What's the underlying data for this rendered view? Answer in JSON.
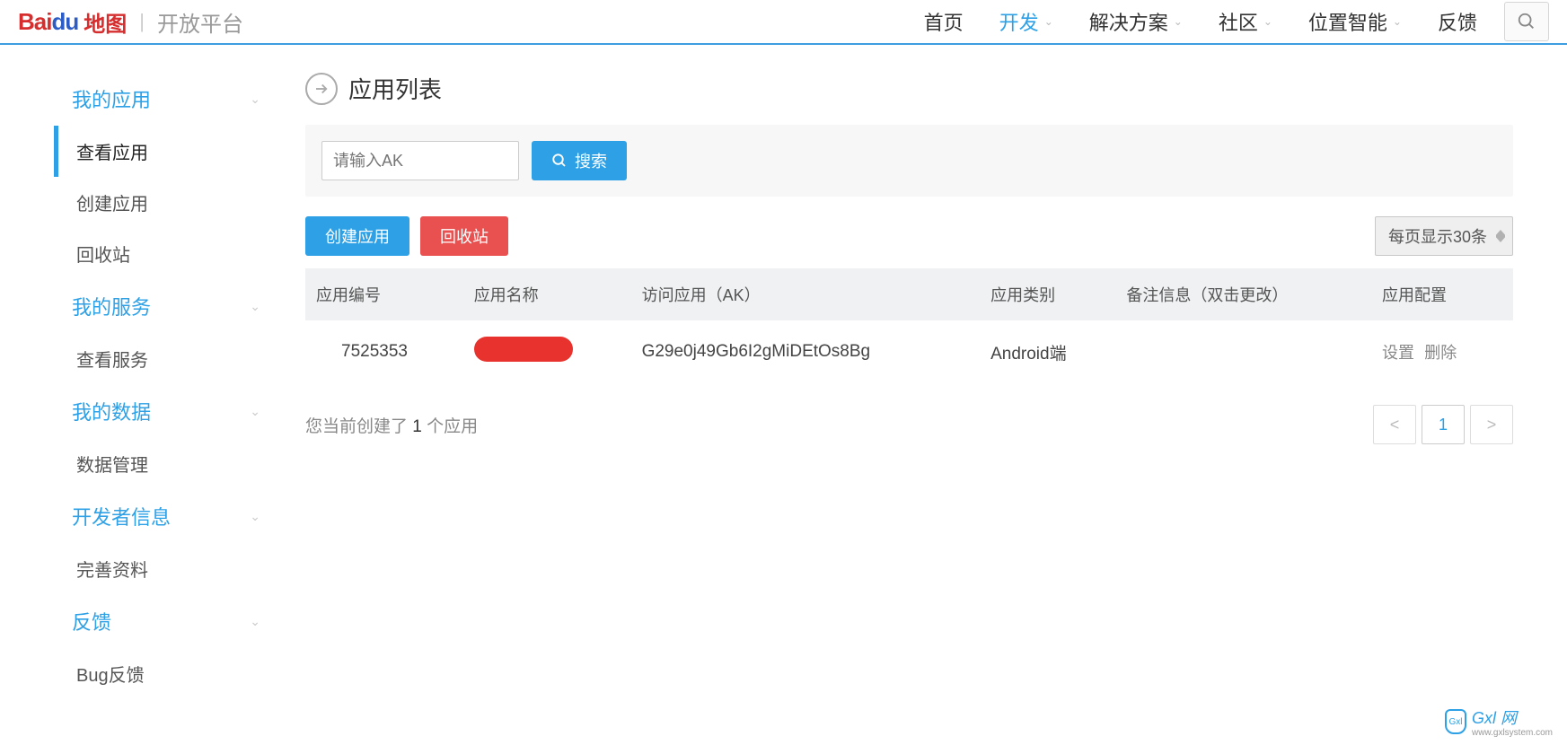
{
  "header": {
    "logo_bai": "Bai",
    "logo_du": "du",
    "logo_sub": "地图",
    "divider": "|",
    "platform": "开放平台",
    "nav": [
      {
        "label": "首页",
        "has_chevron": false,
        "active": false
      },
      {
        "label": "开发",
        "has_chevron": true,
        "active": true
      },
      {
        "label": "解决方案",
        "has_chevron": true,
        "active": false
      },
      {
        "label": "社区",
        "has_chevron": true,
        "active": false
      },
      {
        "label": "位置智能",
        "has_chevron": true,
        "active": false
      },
      {
        "label": "反馈",
        "has_chevron": false,
        "active": false
      }
    ]
  },
  "sidebar": {
    "sections": [
      {
        "title": "我的应用",
        "items": [
          {
            "label": "查看应用",
            "active": true
          },
          {
            "label": "创建应用",
            "active": false
          },
          {
            "label": "回收站",
            "active": false
          }
        ]
      },
      {
        "title": "我的服务",
        "items": [
          {
            "label": "查看服务",
            "active": false
          }
        ]
      },
      {
        "title": "我的数据",
        "items": [
          {
            "label": "数据管理",
            "active": false
          }
        ]
      },
      {
        "title": "开发者信息",
        "items": [
          {
            "label": "完善资料",
            "active": false
          }
        ]
      },
      {
        "title": "反馈",
        "items": [
          {
            "label": "Bug反馈",
            "active": false
          }
        ]
      }
    ]
  },
  "main": {
    "page_title": "应用列表",
    "search_placeholder": "请输入AK",
    "search_btn": "搜索",
    "create_btn": "创建应用",
    "recycle_btn": "回收站",
    "page_size_label": "每页显示30条",
    "table": {
      "headers": [
        "应用编号",
        "应用名称",
        "访问应用（AK）",
        "应用类别",
        "备注信息（双击更改）",
        "应用配置"
      ],
      "rows": [
        {
          "id": "7525353",
          "ak": "G29e0j49Gb6I2gMiDEtOs8Bg",
          "type": "Android端",
          "note": "",
          "action_set": "设置",
          "action_del": "删除"
        }
      ]
    },
    "count_prefix": "您当前创建了 ",
    "count_num": "1",
    "count_suffix": " 个应用",
    "pagination": {
      "prev": "<",
      "current": "1",
      "next": ">"
    }
  },
  "watermark": {
    "badge": "Gxl",
    "text": "Gxl 网",
    "sub": "www.gxlsystem.com"
  }
}
